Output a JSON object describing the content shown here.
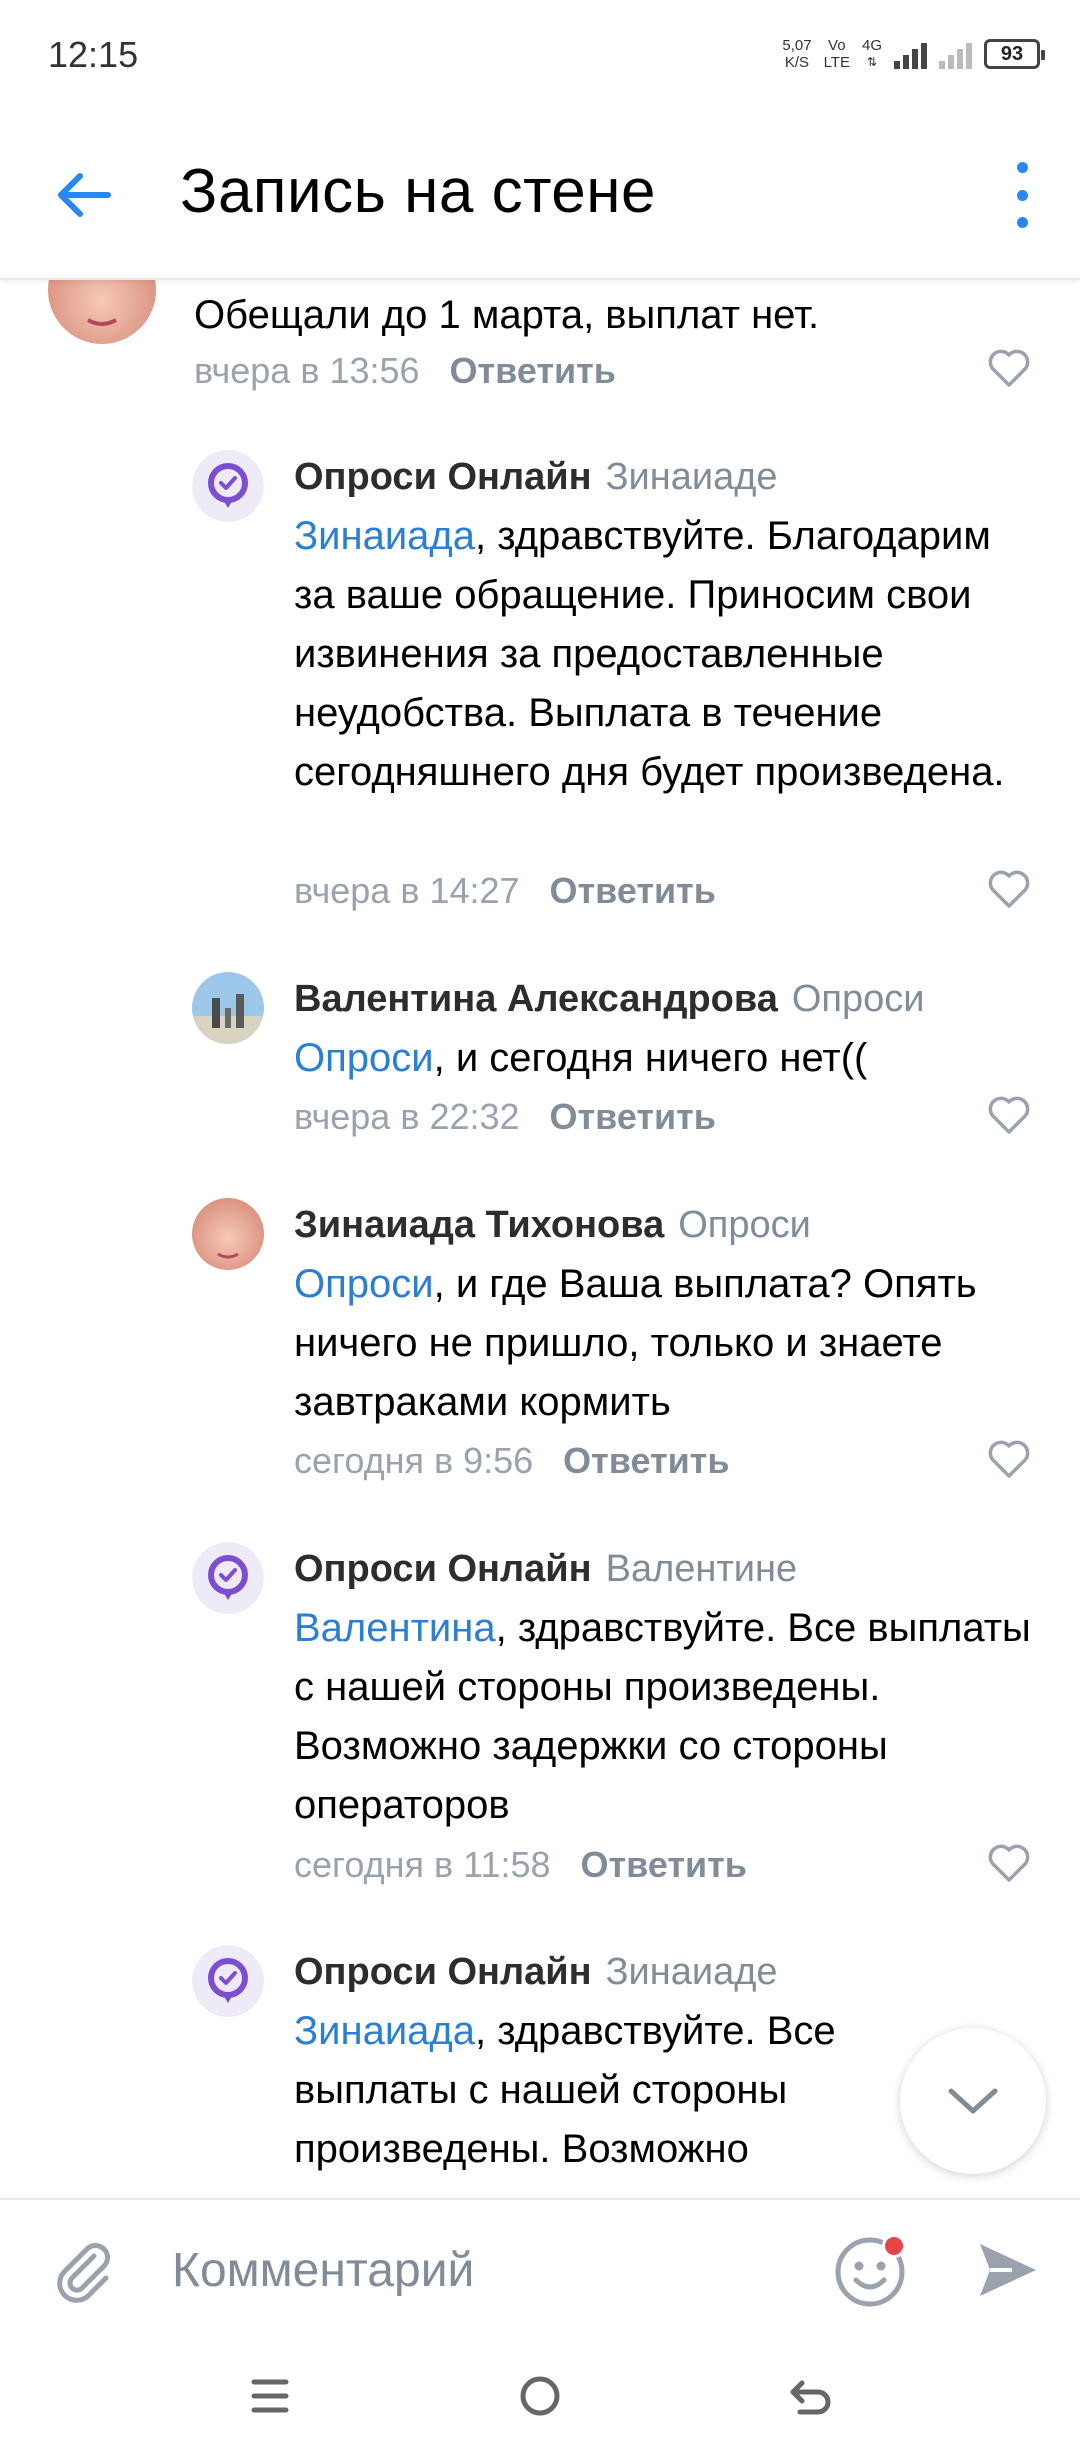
{
  "status_bar": {
    "time": "12:15",
    "speed_value": "5,07",
    "speed_unit": "K/S",
    "volte_top": "Vo",
    "volte_bottom": "LTE",
    "network": "4G",
    "battery": "93"
  },
  "header": {
    "title": "Запись на стене",
    "back_icon": "arrow-left-icon",
    "more_icon": "more-vertical-icon",
    "accent": "#2787f5"
  },
  "comments": [
    {
      "author": "",
      "reply_to": "",
      "mention": "",
      "text": "Обещали до 1 марта, выплат нет.",
      "time": "вчера в 13:56",
      "reply_label": "Ответить"
    },
    {
      "author": "Опроси Онлайн",
      "reply_to": "Зинаиаде",
      "mention": "Зинаиада",
      "text": ", здравствуйте. Благодарим за ваше обращение. Приносим свои извинения за предоставленные неудобства. Выплата в течение сегодняшнего дня будет произведена.",
      "time": "вчера в 14:27",
      "reply_label": "Ответить"
    },
    {
      "author": "Валентина Александрова",
      "reply_to": "Опроси",
      "mention": "Опроси",
      "text": ", и сегодня ничего нет((",
      "time": "вчера в 22:32",
      "reply_label": "Ответить"
    },
    {
      "author": "Зинаиада Тихонова",
      "reply_to": "Опроси",
      "mention": "Опроси",
      "text": ", и где Ваша выплата? Опять ничего не пришло, только и знаете завтраками кормить",
      "time": "сегодня в 9:56",
      "reply_label": "Ответить"
    },
    {
      "author": "Опроси Онлайн",
      "reply_to": "Валентине",
      "mention": "Валентина",
      "text": ", здравствуйте. Все выплаты с нашей стороны произведены. Возможно задержки со стороны операторов",
      "time": "сегодня в 11:58",
      "reply_label": "Ответить"
    },
    {
      "author": "Опроси Онлайн",
      "reply_to": "Зинаиаде",
      "mention": "Зинаиада",
      "text": ", здравствуйте. Все выплаты с нашей стороны произведены. Возможно",
      "time": "",
      "reply_label": ""
    }
  ],
  "composer": {
    "placeholder": "Комментарий",
    "attach_icon": "paperclip-icon",
    "emoji_icon": "smile-icon",
    "send_icon": "send-icon"
  },
  "colors": {
    "mention": "#2a7fd4",
    "meta": "#99a2ad",
    "brand_purple": "#7b4fcf"
  }
}
